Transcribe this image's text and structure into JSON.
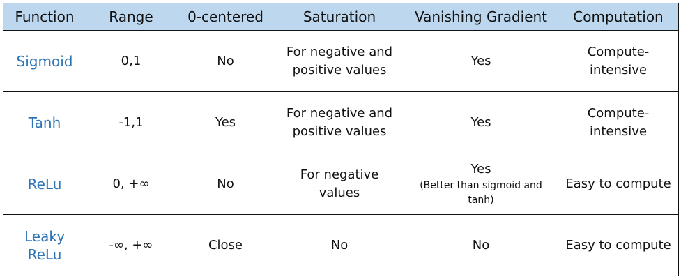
{
  "table": {
    "headers": [
      "Function",
      "Range",
      "0-centered",
      "Saturation",
      "Vanishing Gradient",
      "Computation"
    ],
    "rows": [
      {
        "function": "Sigmoid",
        "range": "0,1",
        "zero_centered": "No",
        "saturation": "For negative and positive values",
        "vanishing_gradient": "Yes",
        "vanishing_gradient_note": "",
        "computation": "Compute-intensive"
      },
      {
        "function": "Tanh",
        "range": "-1,1",
        "zero_centered": "Yes",
        "saturation": "For negative and positive values",
        "vanishing_gradient": "Yes",
        "vanishing_gradient_note": "",
        "computation": "Compute-intensive"
      },
      {
        "function": "ReLu",
        "range": "0, +∞",
        "zero_centered": "No",
        "saturation": "For negative values",
        "vanishing_gradient": "Yes",
        "vanishing_gradient_note": "(Better than sigmoid and tanh)",
        "computation": "Easy to compute"
      },
      {
        "function": "Leaky ReLu",
        "range": "-∞, +∞",
        "zero_centered": "Close",
        "saturation": "No",
        "vanishing_gradient": "No",
        "vanishing_gradient_note": "",
        "computation": "Easy to compute"
      }
    ],
    "colors": {
      "header_background": "#bdd7ee",
      "function_text": "#2e75b6",
      "border": "#111111"
    }
  }
}
